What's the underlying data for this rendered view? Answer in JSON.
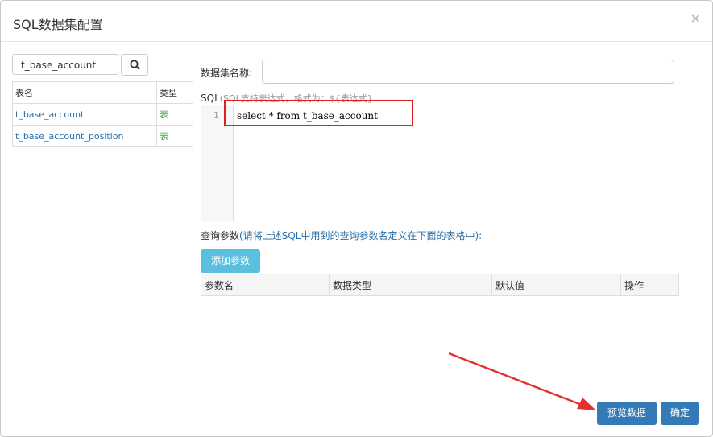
{
  "dialog": {
    "title": "SQL数据集配置",
    "close": "×"
  },
  "search": {
    "value": "t_base_account"
  },
  "tables": {
    "headers": [
      "表名",
      "类型"
    ],
    "rows": [
      {
        "name": "t_base_account",
        "type": "表"
      },
      {
        "name": "t_base_account_position",
        "type": "表"
      }
    ]
  },
  "form": {
    "dataset_label": "数据集名称:",
    "sql_label": "SQL",
    "sql_hint": "(SQL支持表达式，格式为：${表达式}",
    "line_number": "1",
    "sql_code": "select * from t_base_account",
    "params_label": "查询参数",
    "params_hint": "(请将上述SQL中用到的查询参数名定义在下面的表格中):",
    "add_param": "添加参数",
    "param_columns": [
      "参数名",
      "数据类型",
      "默认值",
      "操作"
    ]
  },
  "footer": {
    "preview": "预览数据",
    "confirm": "确定"
  },
  "colors": {
    "highlight": "#e02020",
    "primary": "#337ab7",
    "info": "#5bc0de"
  }
}
